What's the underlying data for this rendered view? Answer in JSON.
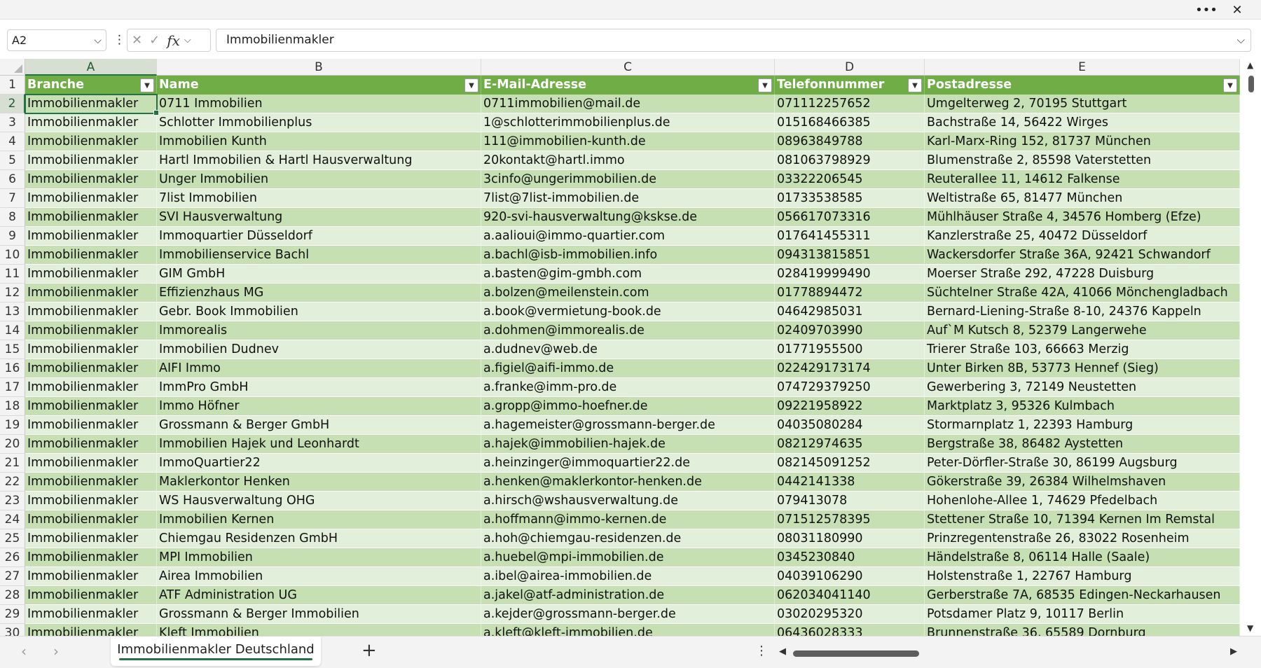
{
  "window": {
    "more_icon": "more-horizontal-icon",
    "close_icon": "close-icon"
  },
  "formula_bar": {
    "name_box": "A2",
    "formula_value": "Immobilienmakler"
  },
  "columns": [
    "A",
    "B",
    "C",
    "D",
    "E"
  ],
  "selected_column": "A",
  "table": {
    "headers": [
      "Branche",
      "Name",
      "E-Mail-Adresse",
      "Telefonnummer",
      "Postadresse"
    ],
    "rows": [
      [
        "Immobilienmakler",
        "0711 Immobilien",
        "0711immobilien@mail.de",
        "071112257652",
        "Umgelterweg 2, 70195 Stuttgart"
      ],
      [
        "Immobilienmakler",
        "Schlotter Immobilienplus",
        "1@schlotterimmobilienplus.de",
        "015168466385",
        "Bachstraße 14, 56422 Wirges"
      ],
      [
        "Immobilienmakler",
        "Immobilien Kunth",
        "111@immobilien-kunth.de",
        "08963849788",
        "Karl-Marx-Ring 152, 81737 München"
      ],
      [
        "Immobilienmakler",
        "Hartl Immobilien & Hartl Hausverwaltung",
        "20kontakt@hartl.immo",
        "081063798929",
        "Blumenstraße 2, 85598 Vaterstetten"
      ],
      [
        "Immobilienmakler",
        "Unger Immobilien",
        "3cinfo@ungerimmobilien.de",
        "03322206545",
        "Reuterallee 11, 14612 Falkense"
      ],
      [
        "Immobilienmakler",
        "7list Immobilien",
        "7list@7list-immobilien.de",
        "01733538585",
        "Weltistraße 65, 81477 München"
      ],
      [
        "Immobilienmakler",
        "SVI Hausverwaltung",
        "920-svi-hausverwaltung@ksksе.de",
        "056617073316",
        "Mühlhäuser Straße 4, 34576 Homberg (Efze)"
      ],
      [
        "Immobilienmakler",
        "Immoquartier Düsseldorf",
        "a.aalioui@immo-quartier.com",
        "017641455311",
        "Kanzlerstraße 25, 40472 Düsseldorf"
      ],
      [
        "Immobilienmakler",
        "Immobilienservice Bachl",
        "a.bachl@isb-immobilien.info",
        "094313815851",
        "Wackersdorfer Straße 36A, 92421 Schwandorf"
      ],
      [
        "Immobilienmakler",
        "GIM GmbH",
        "a.basten@gim-gmbh.com",
        "028419999490",
        "Moerser Straße 292, 47228 Duisburg"
      ],
      [
        "Immobilienmakler",
        "Effizienzhaus MG",
        "a.bolzen@meilenstein.com",
        "01778894472",
        "Süchtelner Straße 42A, 41066 Mönchengladbach"
      ],
      [
        "Immobilienmakler",
        "Gebr. Book Immobilien",
        "a.book@vermietung-book.de",
        "04642985031",
        "Bernard-Liening-Straße 8-10, 24376 Kappeln"
      ],
      [
        "Immobilienmakler",
        "Immorealis",
        "a.dohmen@immorealis.de",
        "02409703990",
        "Auf`M Kutsch 8, 52379 Langerwehe"
      ],
      [
        "Immobilienmakler",
        "Immobilien Dudnev",
        "a.dudnev@web.de",
        "01771955500",
        "Trierer Straße 103, 66663 Merzig"
      ],
      [
        "Immobilienmakler",
        "AIFI Immo",
        "a.figiel@aifi-immo.de",
        "022429173174",
        "Unter Birken 8B, 53773 Hennef (Sieg)"
      ],
      [
        "Immobilienmakler",
        "ImmPro GmbH",
        "a.franke@imm-pro.de",
        "074729379250",
        "Gewerbering 3, 72149 Neustetten"
      ],
      [
        "Immobilienmakler",
        "Immo Höfner",
        "a.gropp@immo-hoefner.de",
        "09221958922",
        "Marktplatz 3, 95326 Kulmbach"
      ],
      [
        "Immobilienmakler",
        "Grossmann & Berger GmbH",
        "a.hagemeister@grossmann-berger.de",
        "04035080284",
        "Stormarnplatz 1, 22393 Hamburg"
      ],
      [
        "Immobilienmakler",
        "Immobilien Hajek und Leonhardt",
        "a.hajek@immobilien-hajek.de",
        "08212974635",
        "Bergstraße 38, 86482 Aystetten"
      ],
      [
        "Immobilienmakler",
        "ImmoQuartier22",
        "a.heinzinger@immoquartier22.de",
        "082145091252",
        "Peter-Dörfler-Straße 30, 86199 Augsburg"
      ],
      [
        "Immobilienmakler",
        "Maklerkontor Henken",
        "a.henken@maklerkontor-henken.de",
        "0442141338",
        "Gökerstraße 39, 26384 Wilhelmshaven"
      ],
      [
        "Immobilienmakler",
        "WS Hausverwaltung OHG",
        "a.hirsch@wshausverwaltung.de",
        "079413078",
        "Hohenlohe-Allee 1, 74629 Pfedelbach"
      ],
      [
        "Immobilienmakler",
        "Immobilien Kernen",
        "a.hoffmann@immo-kernen.de",
        "071512578395",
        "Stettener Straße 10, 71394 Kernen Im Remstal"
      ],
      [
        "Immobilienmakler",
        "Chiemgau Residenzen GmbH",
        "a.hoh@chiemgau-residenzen.de",
        "08031180990",
        "Prinzregentenstraße 26, 83022 Rosenheim"
      ],
      [
        "Immobilienmakler",
        "MPI Immobilien",
        "a.huebel@mpi-immobilien.de",
        "0345230840",
        "Händelstraße 8, 06114 Halle (Saale)"
      ],
      [
        "Immobilienmakler",
        "Airea Immobilien",
        "a.ibel@airea-immobilien.de",
        "04039106290",
        "Holstenstraße 1, 22767 Hamburg"
      ],
      [
        "Immobilienmakler",
        "ATF Administration UG",
        "a.jakel@atf-administration.de",
        "062034041140",
        "Gerberstraße 7A, 68535 Edingen-Neckarhausen"
      ],
      [
        "Immobilienmakler",
        "Grossmann & Berger Immobilien",
        "a.kejder@grossmann-berger.de",
        "03020295320",
        "Potsdamer Platz 9, 10117 Berlin"
      ],
      [
        "Immobilienmakler",
        "Kleft Immobilien",
        "a.kleft@kleft-immobilien.de",
        "06436028333",
        "Brunnenstraße 36, 65589 Dornburg"
      ]
    ]
  },
  "sheet_tabs": [
    {
      "label": "Immobilienmakler Deutschland",
      "active": true
    }
  ],
  "colors": {
    "header_green": "#70ad47",
    "band_dark": "#c6e0b4",
    "band_light": "#e2efda",
    "accent": "#217346"
  }
}
